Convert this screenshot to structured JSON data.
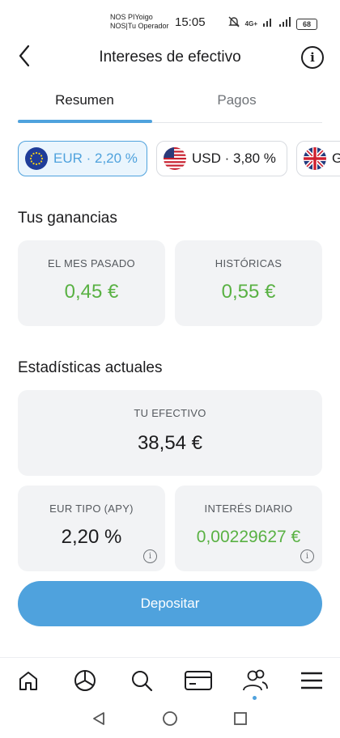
{
  "status_bar": {
    "carrier_line1": "NOS PIYoigo",
    "carrier_line2": "NOS|Tu Operador",
    "time": "15:05",
    "network": "4G+",
    "battery": "68"
  },
  "header": {
    "title": "Intereses de efectivo"
  },
  "tabs": [
    {
      "label": "Resumen",
      "active": true
    },
    {
      "label": "Pagos",
      "active": false
    }
  ],
  "currencies": [
    {
      "label": "EUR · 2,20 %",
      "flag": "eu-flag",
      "selected": true
    },
    {
      "label": "USD · 3,80 %",
      "flag": "us-flag",
      "selected": false
    },
    {
      "label": "G",
      "flag": "uk-flag",
      "selected": false
    }
  ],
  "earnings": {
    "title": "Tus ganancias",
    "last_month_label": "EL MES PASADO",
    "last_month_value": "0,45 €",
    "historic_label": "HISTÓRICAS",
    "historic_value": "0,55 €"
  },
  "stats": {
    "title": "Estadísticas actuales",
    "cash_label": "TU EFECTIVO",
    "cash_value": "38,54 €",
    "rate_label": "EUR TIPO (APY)",
    "rate_value": "2,20 %",
    "daily_label": "INTERÉS DIARIO",
    "daily_value": "0,00229627 €"
  },
  "deposit_label": "Depositar",
  "bottom_nav": [
    "home-icon",
    "portfolio-chart-icon",
    "search-icon",
    "card-icon",
    "community-icon",
    "menu-icon"
  ],
  "colors": {
    "accent": "#4fa2dd",
    "positive": "#59b143",
    "card_bg": "#f2f3f5"
  }
}
